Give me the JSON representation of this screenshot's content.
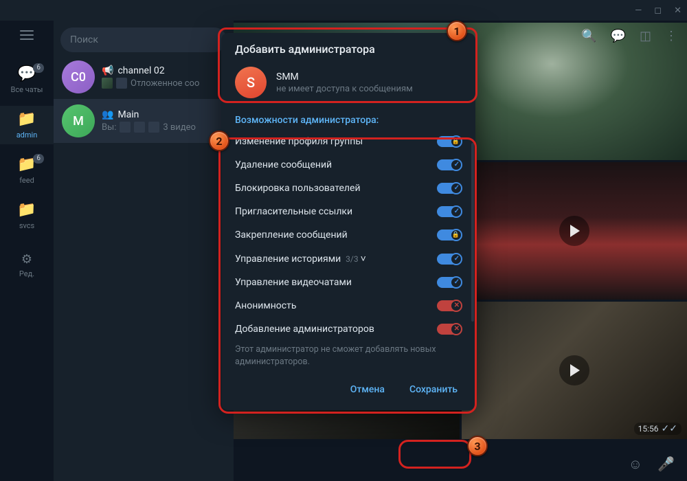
{
  "titlebar": {
    "min": "—",
    "max": "◻",
    "close": "✕"
  },
  "search": {
    "placeholder": "Поиск"
  },
  "folders": {
    "all": {
      "label": "Все чаты",
      "badge": "6"
    },
    "admin": {
      "label": "admin"
    },
    "feed": {
      "label": "feed",
      "badge": "6"
    },
    "svcs": {
      "label": "svcs"
    },
    "edit": {
      "label": "Ред."
    }
  },
  "chats": {
    "c0": {
      "avatar_letter": "C0",
      "name": "channel 02",
      "preview_prefix": "",
      "preview_text": "Отложенное соо"
    },
    "main": {
      "avatar_letter": "M",
      "name": "Main",
      "preview_prefix": "Вы:",
      "preview_text": "3 видео"
    }
  },
  "modal": {
    "title": "Добавить администратора",
    "user": {
      "letter": "S",
      "name": "SMM",
      "status": "не имеет доступа к сообщениям"
    },
    "section_title": "Возможности администратора:",
    "permissions": [
      {
        "label": "Изменение профиля группы",
        "state": "on",
        "icon": "lock"
      },
      {
        "label": "Удаление сообщений",
        "state": "on",
        "icon": "chk"
      },
      {
        "label": "Блокировка пользователей",
        "state": "on",
        "icon": "chk"
      },
      {
        "label": "Пригласительные ссылки",
        "state": "on",
        "icon": "chk"
      },
      {
        "label": "Закрепление сообщений",
        "state": "on",
        "icon": "lock"
      },
      {
        "label": "Управление историями",
        "sub": "3/3",
        "state": "on",
        "icon": "chk",
        "expandable": true
      },
      {
        "label": "Управление видеочатами",
        "state": "on",
        "icon": "chk"
      },
      {
        "label": "Анонимность",
        "state": "off",
        "icon": "cross"
      },
      {
        "label": "Добавление администраторов",
        "state": "off",
        "icon": "cross"
      }
    ],
    "hint": "Этот администратор не сможет добавлять новых администраторов.",
    "cancel": "Отмена",
    "save": "Сохранить"
  },
  "media_time": "15:56",
  "callouts": {
    "n1": "1",
    "n2": "2",
    "n3": "3"
  }
}
